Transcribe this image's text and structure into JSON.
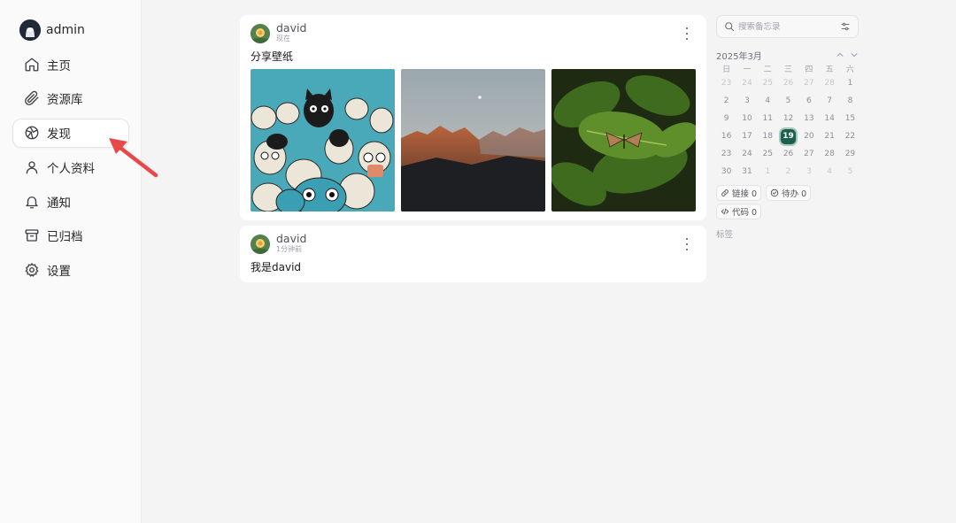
{
  "sidebar": {
    "user": {
      "name": "admin"
    },
    "items": [
      {
        "label": "主页",
        "icon": "home-icon"
      },
      {
        "label": "资源库",
        "icon": "paperclip-icon"
      },
      {
        "label": "发现",
        "icon": "compass-icon",
        "active": true
      },
      {
        "label": "个人资料",
        "icon": "user-icon"
      },
      {
        "label": "通知",
        "icon": "bell-icon"
      },
      {
        "label": "已归档",
        "icon": "archive-icon"
      },
      {
        "label": "设置",
        "icon": "gear-icon"
      }
    ]
  },
  "feed": {
    "posts": [
      {
        "author": "david",
        "time": "现在",
        "content": "分享壁纸",
        "images": [
          "cats-illustration",
          "mountain-landscape",
          "butterfly-on-leaves"
        ]
      },
      {
        "author": "david",
        "time": "1分钟前",
        "content": "我是david"
      }
    ]
  },
  "right_panel": {
    "search_placeholder": "搜索备忘录",
    "calendar": {
      "title": "2025年3月",
      "weekdays": [
        "日",
        "一",
        "二",
        "三",
        "四",
        "五",
        "六"
      ],
      "weeks": [
        [
          "23",
          "24",
          "25",
          "26",
          "27",
          "28",
          "1"
        ],
        [
          "2",
          "3",
          "4",
          "5",
          "6",
          "7",
          "8"
        ],
        [
          "9",
          "10",
          "11",
          "12",
          "13",
          "14",
          "15"
        ],
        [
          "16",
          "17",
          "18",
          "19",
          "20",
          "21",
          "22"
        ],
        [
          "23",
          "24",
          "25",
          "26",
          "27",
          "28",
          "29"
        ],
        [
          "30",
          "31",
          "1",
          "2",
          "3",
          "4",
          "5"
        ]
      ],
      "today": "19"
    },
    "stats": [
      {
        "label": "链接 0",
        "icon": "link-icon"
      },
      {
        "label": "待办 0",
        "icon": "check-circle-icon"
      },
      {
        "label": "代码 0",
        "icon": "code-icon"
      }
    ],
    "tags_label": "标签"
  },
  "colors": {
    "accent": "#1e5f4e",
    "annotation_arrow": "#e84848"
  }
}
